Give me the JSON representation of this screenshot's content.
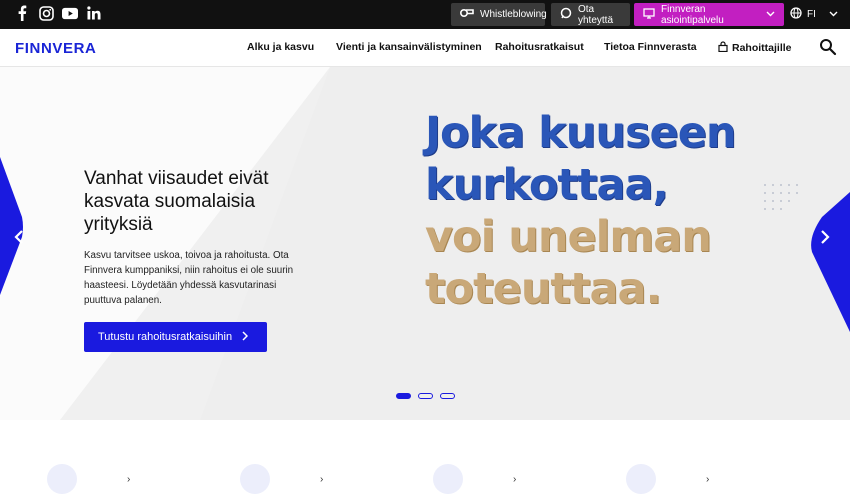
{
  "topbar": {
    "social": [
      "facebook-icon",
      "instagram-icon",
      "youtube-icon",
      "linkedin-icon"
    ],
    "whistleblowing": "Whistleblowing",
    "contact": "Ota yhteyttä",
    "service": "Finnveran asiointipalvelu",
    "language": "FI"
  },
  "nav": {
    "logo": "FINNVERA",
    "items": [
      "Alku ja kasvu",
      "Vienti ja kansainvälistyminen",
      "Rahoitusratkaisut",
      "Tietoa Finnverasta",
      "Rahoittajille"
    ]
  },
  "hero": {
    "headline": "Vanhat viisaudet eivät kasvata suomalaisia yrityksiä",
    "body": "Kasvu tarvitsee uskoa, toivoa ja rahoitusta. Ota Finnvera kumppaniksi, niin rahoitus ei ole suurin haasteesi. Löydetään yhdessä kasvutarinasi puuttuva palanen.",
    "cta": "Tutustu rahoitusratkaisuihin",
    "art_lines": [
      "Joka kuuseen",
      "kurkottaa,",
      "voi unelman",
      "toteuttaa."
    ],
    "slides": 3,
    "active_slide": 1
  },
  "colors": {
    "brand": "#1a1adf",
    "service": "#c21fc1",
    "topbar": "#111111"
  }
}
